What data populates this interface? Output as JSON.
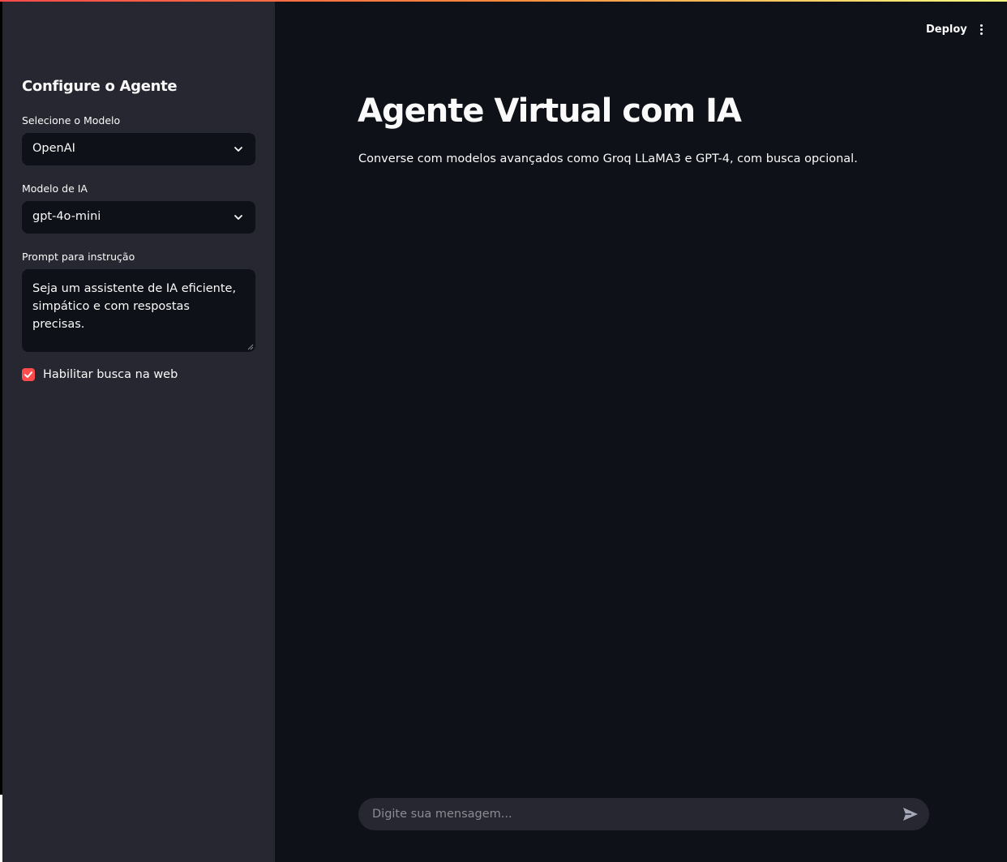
{
  "header": {
    "deploy_label": "Deploy",
    "menu_icon": "more-vertical-icon"
  },
  "sidebar": {
    "title": "Configure o Agente",
    "provider": {
      "label": "Selecione o Modelo",
      "value": "OpenAI"
    },
    "model": {
      "label": "Modelo de IA",
      "value": "gpt-4o-mini"
    },
    "prompt": {
      "label": "Prompt para instrução",
      "value": "Seja um assistente de IA eficiente, simpático e com respostas precisas."
    },
    "web_search": {
      "label": "Habilitar busca na web",
      "checked": true
    }
  },
  "main": {
    "title": "Agente Virtual com IA",
    "subtitle": "Converse com modelos avançados como Groq LLaMA3 e GPT-4, com busca opcional."
  },
  "chat": {
    "placeholder": "Digite sua mensagem...",
    "send_icon": "send-icon"
  },
  "colors": {
    "accent": "#ff4b4b",
    "background": "#0e1117",
    "sidebar": "#262730",
    "text": "#fafafa"
  }
}
